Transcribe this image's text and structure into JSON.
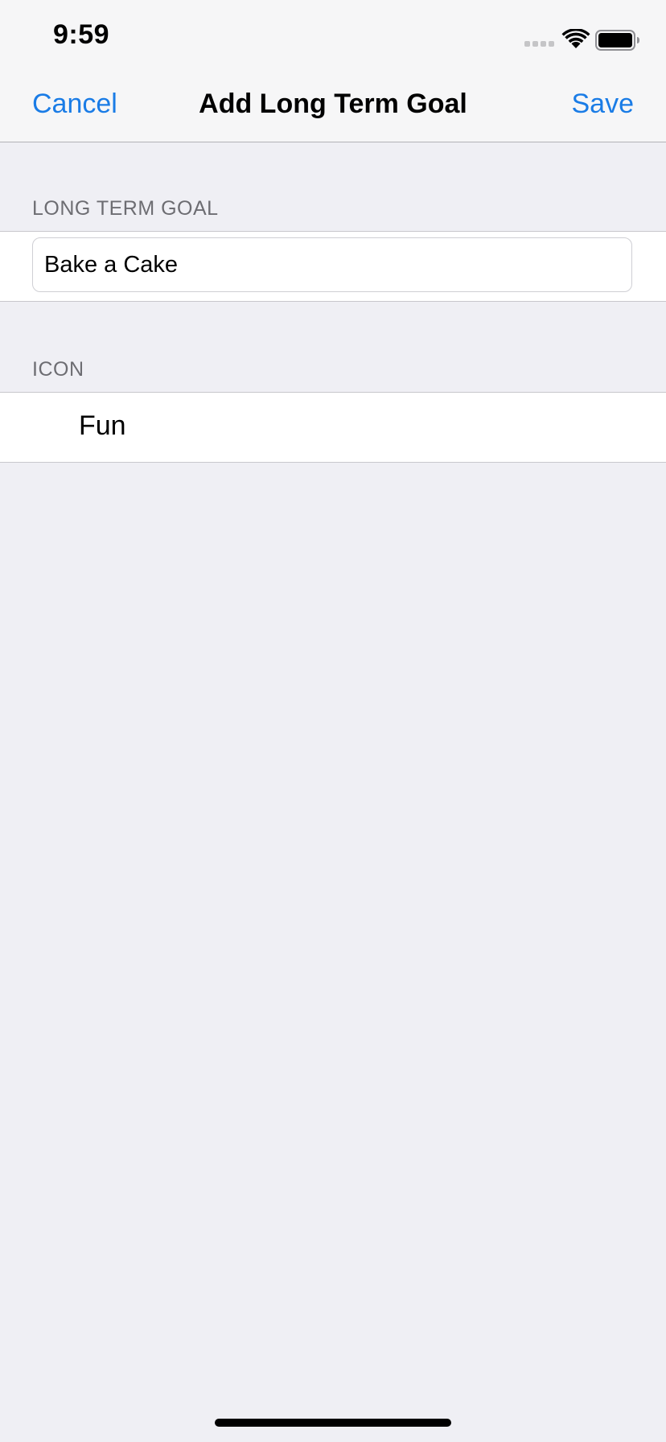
{
  "status_bar": {
    "time": "9:59",
    "signal_icon": "cellular-signal-icon",
    "wifi_icon": "wifi-icon",
    "battery_icon": "battery-icon"
  },
  "nav": {
    "cancel_label": "Cancel",
    "title": "Add Long Term Goal",
    "save_label": "Save"
  },
  "goal_section": {
    "header": "LONG TERM GOAL",
    "value": "Bake a Cake"
  },
  "icon_section": {
    "header": "ICON",
    "value": "Fun"
  },
  "colors": {
    "accent": "#1A7CE6",
    "background": "#EFEFF4",
    "header_text": "#6D6D72"
  }
}
